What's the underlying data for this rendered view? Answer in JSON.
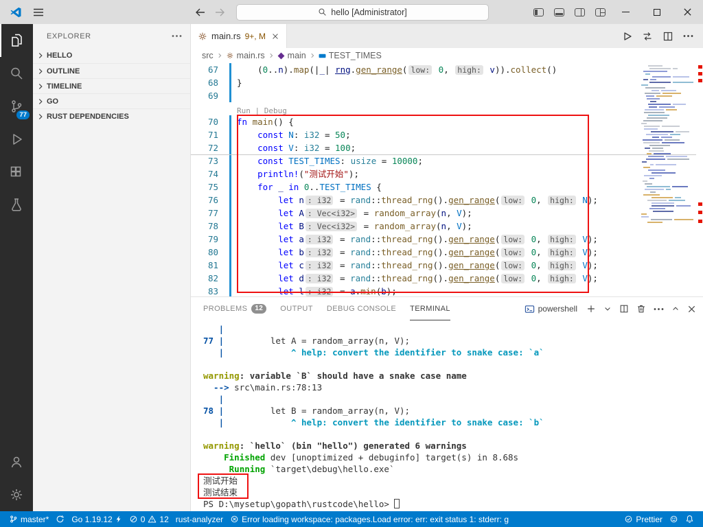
{
  "titlebar": {
    "search_value": "hello [Administrator]"
  },
  "activity_bar": {
    "scm_badge": "77"
  },
  "sidebar": {
    "header": "EXPLORER",
    "sections": [
      "HELLO",
      "OUTLINE",
      "TIMELINE",
      "GO",
      "RUST DEPENDENCIES"
    ]
  },
  "editor": {
    "tab": {
      "title": "main.rs",
      "decoration": "9+, M"
    },
    "breadcrumbs": [
      {
        "label": "src"
      },
      {
        "label": "main.rs",
        "icon": "rust"
      },
      {
        "label": "main",
        "icon": "method"
      },
      {
        "label": "TEST_TIMES",
        "icon": "constant"
      }
    ],
    "code_lines": [
      {
        "num": "67",
        "seg": [
          [
            "p",
            "    ("
          ],
          [
            "n",
            "0"
          ],
          [
            "p",
            ".."
          ],
          [
            "v",
            "n"
          ],
          [
            "p",
            ")."
          ],
          [
            "f",
            "map"
          ],
          [
            "p",
            "(|"
          ],
          [
            "v",
            "_"
          ],
          [
            "p",
            "| "
          ],
          [
            "vu",
            "rng"
          ],
          [
            "p",
            "."
          ],
          [
            "fu",
            "gen_range"
          ],
          [
            "p",
            "("
          ],
          [
            "h",
            "low:"
          ],
          [
            "p",
            " "
          ],
          [
            "n",
            "0"
          ],
          [
            "p",
            ", "
          ],
          [
            "h",
            "high:"
          ],
          [
            "p",
            " "
          ],
          [
            "v",
            "v"
          ],
          [
            "p",
            "))."
          ],
          [
            "f",
            "collect"
          ],
          [
            "p",
            "()"
          ]
        ]
      },
      {
        "num": "68",
        "seg": [
          [
            "p",
            "}"
          ]
        ]
      },
      {
        "num": "69",
        "seg": []
      },
      {
        "num": "",
        "lens": true,
        "seg": [
          [
            "lensl",
            "Run"
          ],
          [
            "lens",
            " | "
          ],
          [
            "lensl",
            "Debug"
          ]
        ]
      },
      {
        "num": "70",
        "seg": [
          [
            "k",
            "fn"
          ],
          [
            "p",
            " "
          ],
          [
            "f",
            "main"
          ],
          [
            "p",
            "() {"
          ]
        ]
      },
      {
        "num": "71",
        "seg": [
          [
            "p",
            "    "
          ],
          [
            "k",
            "const"
          ],
          [
            "p",
            " "
          ],
          [
            "c",
            "N"
          ],
          [
            "p",
            ": "
          ],
          [
            "t",
            "i32"
          ],
          [
            "p",
            " = "
          ],
          [
            "n",
            "50"
          ],
          [
            "p",
            ";"
          ]
        ]
      },
      {
        "num": "72",
        "seg": [
          [
            "p",
            "    "
          ],
          [
            "k",
            "const"
          ],
          [
            "p",
            " "
          ],
          [
            "c",
            "V"
          ],
          [
            "p",
            ": "
          ],
          [
            "t",
            "i32"
          ],
          [
            "p",
            " = "
          ],
          [
            "n",
            "100"
          ],
          [
            "p",
            ";"
          ]
        ]
      },
      {
        "num": "73",
        "seg": [
          [
            "p",
            "    "
          ],
          [
            "k",
            "const"
          ],
          [
            "p",
            " "
          ],
          [
            "c",
            "TEST_TIMES"
          ],
          [
            "p",
            ": "
          ],
          [
            "t",
            "usize"
          ],
          [
            "p",
            " = "
          ],
          [
            "n",
            "10000"
          ],
          [
            "p",
            ";"
          ]
        ]
      },
      {
        "num": "74",
        "seg": [
          [
            "p",
            "    "
          ],
          [
            "k",
            "println!"
          ],
          [
            "p",
            "("
          ],
          [
            "s",
            "\"测试开始\""
          ],
          [
            "p",
            ");"
          ]
        ]
      },
      {
        "num": "75",
        "seg": [
          [
            "p",
            "    "
          ],
          [
            "k",
            "for"
          ],
          [
            "p",
            " "
          ],
          [
            "v",
            "_"
          ],
          [
            "p",
            " "
          ],
          [
            "k",
            "in"
          ],
          [
            "p",
            " "
          ],
          [
            "n",
            "0"
          ],
          [
            "p",
            ".."
          ],
          [
            "c",
            "TEST_TIMES"
          ],
          [
            "p",
            " {"
          ]
        ]
      },
      {
        "num": "76",
        "seg": [
          [
            "p",
            "        "
          ],
          [
            "k",
            "let"
          ],
          [
            "p",
            " "
          ],
          [
            "v",
            "n"
          ],
          [
            "h",
            ": i32"
          ],
          [
            "p",
            " = "
          ],
          [
            "t",
            "rand"
          ],
          [
            "p",
            "::"
          ],
          [
            "f",
            "thread_rng"
          ],
          [
            "p",
            "()."
          ],
          [
            "fu",
            "gen_range"
          ],
          [
            "p",
            "("
          ],
          [
            "h",
            "low:"
          ],
          [
            "p",
            " "
          ],
          [
            "n",
            "0"
          ],
          [
            "p",
            ", "
          ],
          [
            "h",
            "high:"
          ],
          [
            "p",
            " "
          ],
          [
            "c",
            "N"
          ],
          [
            "p",
            ");"
          ]
        ]
      },
      {
        "num": "77",
        "seg": [
          [
            "p",
            "        "
          ],
          [
            "k",
            "let"
          ],
          [
            "p",
            " "
          ],
          [
            "v",
            "A"
          ],
          [
            "h",
            ": Vec<i32>"
          ],
          [
            "p",
            " = "
          ],
          [
            "f",
            "random_array"
          ],
          [
            "p",
            "("
          ],
          [
            "v",
            "n"
          ],
          [
            "p",
            ", "
          ],
          [
            "c",
            "V"
          ],
          [
            "p",
            ");"
          ]
        ]
      },
      {
        "num": "78",
        "seg": [
          [
            "p",
            "        "
          ],
          [
            "k",
            "let"
          ],
          [
            "p",
            " "
          ],
          [
            "v",
            "B"
          ],
          [
            "h",
            ": Vec<i32>"
          ],
          [
            "p",
            " = "
          ],
          [
            "f",
            "random_array"
          ],
          [
            "p",
            "("
          ],
          [
            "v",
            "n"
          ],
          [
            "p",
            ", "
          ],
          [
            "c",
            "V"
          ],
          [
            "p",
            ");"
          ]
        ]
      },
      {
        "num": "79",
        "seg": [
          [
            "p",
            "        "
          ],
          [
            "k",
            "let"
          ],
          [
            "p",
            " "
          ],
          [
            "v",
            "a"
          ],
          [
            "h",
            ": i32"
          ],
          [
            "p",
            " = "
          ],
          [
            "t",
            "rand"
          ],
          [
            "p",
            "::"
          ],
          [
            "f",
            "thread_rng"
          ],
          [
            "p",
            "()."
          ],
          [
            "fu",
            "gen_range"
          ],
          [
            "p",
            "("
          ],
          [
            "h",
            "low:"
          ],
          [
            "p",
            " "
          ],
          [
            "n",
            "0"
          ],
          [
            "p",
            ", "
          ],
          [
            "h",
            "high:"
          ],
          [
            "p",
            " "
          ],
          [
            "c",
            "V"
          ],
          [
            "p",
            ");"
          ]
        ]
      },
      {
        "num": "80",
        "seg": [
          [
            "p",
            "        "
          ],
          [
            "k",
            "let"
          ],
          [
            "p",
            " "
          ],
          [
            "v",
            "b"
          ],
          [
            "h",
            ": i32"
          ],
          [
            "p",
            " = "
          ],
          [
            "t",
            "rand"
          ],
          [
            "p",
            "::"
          ],
          [
            "f",
            "thread_rng"
          ],
          [
            "p",
            "()."
          ],
          [
            "fu",
            "gen_range"
          ],
          [
            "p",
            "("
          ],
          [
            "h",
            "low:"
          ],
          [
            "p",
            " "
          ],
          [
            "n",
            "0"
          ],
          [
            "p",
            ", "
          ],
          [
            "h",
            "high:"
          ],
          [
            "p",
            " "
          ],
          [
            "c",
            "V"
          ],
          [
            "p",
            ");"
          ]
        ]
      },
      {
        "num": "81",
        "seg": [
          [
            "p",
            "        "
          ],
          [
            "k",
            "let"
          ],
          [
            "p",
            " "
          ],
          [
            "v",
            "c"
          ],
          [
            "h",
            ": i32"
          ],
          [
            "p",
            " = "
          ],
          [
            "t",
            "rand"
          ],
          [
            "p",
            "::"
          ],
          [
            "f",
            "thread_rng"
          ],
          [
            "p",
            "()."
          ],
          [
            "fu",
            "gen_range"
          ],
          [
            "p",
            "("
          ],
          [
            "h",
            "low:"
          ],
          [
            "p",
            " "
          ],
          [
            "n",
            "0"
          ],
          [
            "p",
            ", "
          ],
          [
            "h",
            "high:"
          ],
          [
            "p",
            " "
          ],
          [
            "c",
            "V"
          ],
          [
            "p",
            ");"
          ]
        ]
      },
      {
        "num": "82",
        "seg": [
          [
            "p",
            "        "
          ],
          [
            "k",
            "let"
          ],
          [
            "p",
            " "
          ],
          [
            "v",
            "d"
          ],
          [
            "h",
            ": i32"
          ],
          [
            "p",
            " = "
          ],
          [
            "t",
            "rand"
          ],
          [
            "p",
            "::"
          ],
          [
            "f",
            "thread_rng"
          ],
          [
            "p",
            "()."
          ],
          [
            "fu",
            "gen_range"
          ],
          [
            "p",
            "("
          ],
          [
            "h",
            "low:"
          ],
          [
            "p",
            " "
          ],
          [
            "n",
            "0"
          ],
          [
            "p",
            ", "
          ],
          [
            "h",
            "high:"
          ],
          [
            "p",
            " "
          ],
          [
            "c",
            "V"
          ],
          [
            "p",
            ");"
          ]
        ]
      },
      {
        "num": "83",
        "seg": [
          [
            "p",
            "        "
          ],
          [
            "k",
            "let"
          ],
          [
            "p",
            " "
          ],
          [
            "v",
            "l"
          ],
          [
            "h",
            ": i32"
          ],
          [
            "p",
            " = "
          ],
          [
            "v",
            "a"
          ],
          [
            "p",
            "."
          ],
          [
            "f",
            "min"
          ],
          [
            "p",
            "("
          ],
          [
            "v",
            "b"
          ],
          [
            "p",
            ");"
          ]
        ]
      }
    ]
  },
  "panel": {
    "tabs": [
      {
        "label": "PROBLEMS",
        "badge": "12"
      },
      {
        "label": "OUTPUT"
      },
      {
        "label": "DEBUG CONSOLE"
      },
      {
        "label": "TERMINAL",
        "active": true
      }
    ],
    "shell": "powershell"
  },
  "terminal": {
    "lines": [
      {
        "seg": [
          [
            "b",
            "   |"
          ]
        ]
      },
      {
        "seg": [
          [
            "b",
            "77 | "
          ],
          [
            "d",
            "        let A = random_array(n, V);"
          ]
        ]
      },
      {
        "seg": [
          [
            "b",
            "   | "
          ],
          [
            "d",
            "            "
          ],
          [
            "cy",
            "^ help: convert the identifier to snake case: `a`"
          ]
        ]
      },
      {
        "seg": []
      },
      {
        "seg": [
          [
            "y",
            "warning"
          ],
          [
            "db",
            ": variable `B` should have a snake case name"
          ]
        ]
      },
      {
        "seg": [
          [
            "b",
            "  --> "
          ],
          [
            "d",
            "src\\main.rs:78:13"
          ]
        ]
      },
      {
        "seg": [
          [
            "b",
            "   |"
          ]
        ]
      },
      {
        "seg": [
          [
            "b",
            "78 | "
          ],
          [
            "d",
            "        let B = random_array(n, V);"
          ]
        ]
      },
      {
        "seg": [
          [
            "b",
            "   | "
          ],
          [
            "d",
            "            "
          ],
          [
            "cy",
            "^ help: convert the identifier to snake case: `b`"
          ]
        ]
      },
      {
        "seg": []
      },
      {
        "seg": [
          [
            "y",
            "warning"
          ],
          [
            "db",
            ": `hello` (bin \"hello\") generated 6 warnings"
          ]
        ]
      },
      {
        "seg": [
          [
            "d",
            "    "
          ],
          [
            "g",
            "Finished"
          ],
          [
            "d",
            " dev [unoptimized + debuginfo] target(s) in 8.68s"
          ]
        ]
      },
      {
        "seg": [
          [
            "d",
            "     "
          ],
          [
            "g",
            "Running"
          ],
          [
            "d",
            " `target\\debug\\hello.exe`"
          ]
        ]
      },
      {
        "seg": [
          [
            "d",
            "测试开始"
          ]
        ]
      },
      {
        "seg": [
          [
            "d",
            "测试结束"
          ]
        ]
      },
      {
        "seg": [
          [
            "d",
            "PS D:\\mysetup\\gopath\\rustcode\\hello> "
          ],
          [
            "cursor",
            ""
          ]
        ]
      }
    ]
  },
  "status_bar": {
    "branch": "master*",
    "go_version": "Go 1.19.12",
    "errors": "0",
    "warnings": "12",
    "rust_analyzer": "rust-analyzer",
    "message": "Error loading workspace: packages.Load error: err: exit status 1: stderr: g",
    "prettier": "Prettier"
  },
  "annotations": {
    "color": "#ee1111"
  }
}
